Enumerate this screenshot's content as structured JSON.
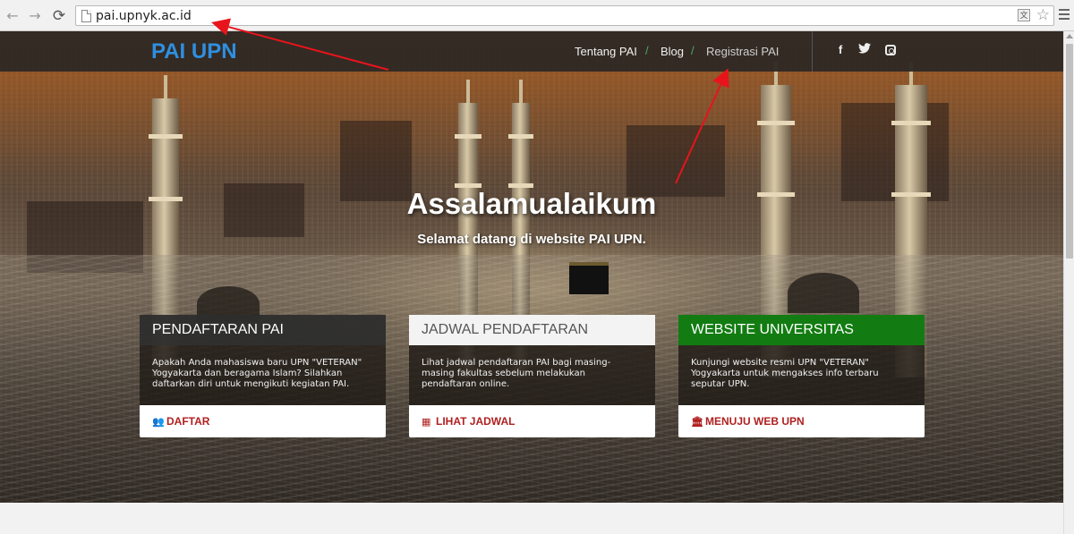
{
  "browser": {
    "url": "pai.upnyk.ac.id",
    "back_icon": "←",
    "forward_icon": "→",
    "reload_icon": "⟳",
    "star_icon": "☆",
    "translate_icon": "文"
  },
  "site": {
    "brand": "PAI UPN",
    "nav": [
      {
        "label": "Tentang PAI"
      },
      {
        "label": "Blog"
      },
      {
        "label": "Registrasi PAI"
      }
    ],
    "nav_separator": "/",
    "social": {
      "facebook": "f",
      "twitter": "🐦"
    }
  },
  "hero": {
    "title": "Assalamualaikum",
    "subtitle": "Selamat datang di website PAI UPN."
  },
  "cards": [
    {
      "title": "PENDAFTARAN PAI",
      "body": "Apakah Anda mahasiswa baru UPN \"VETERAN\" Yogyakarta dan beragama Islam? Silahkan daftarkan diri untuk mengikuti kegiatan PAI.",
      "action": "DAFTAR",
      "icon": "👥"
    },
    {
      "title": "JADWAL PENDAFTARAN",
      "body": "Lihat jadwal pendaftaran PAI bagi masing-masing fakultas sebelum melakukan pendaftaran online.",
      "action": "LIHAT JADWAL",
      "icon": "▦"
    },
    {
      "title": "WEBSITE UNIVERSITAS",
      "body": "Kunjungi website resmi UPN \"VETERAN\" Yogyakarta untuk mengakses info terbaru seputar UPN.",
      "action": "MENUJU WEB UPN",
      "icon": "🏛"
    }
  ],
  "colors": {
    "brand": "#2f8fe0",
    "nav_separator": "#4aa86a",
    "card_action": "#b02020",
    "card3_header": "#127c12",
    "annotation": "#e8141c"
  }
}
